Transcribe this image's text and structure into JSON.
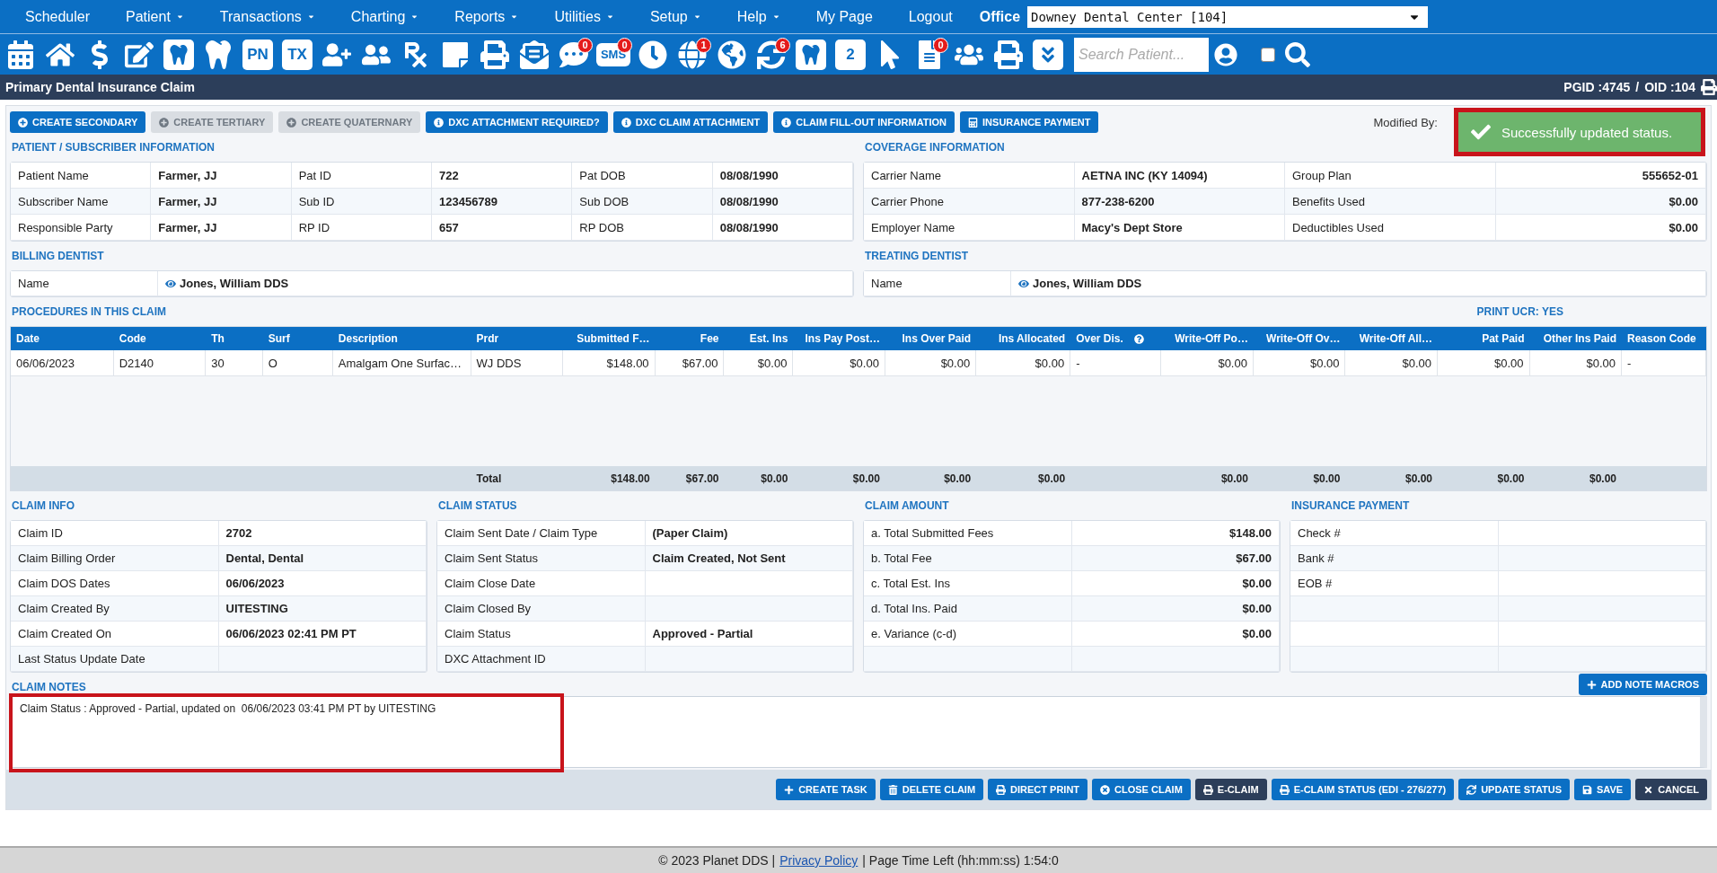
{
  "nav": {
    "items": [
      {
        "label": "Scheduler",
        "dropdown": false
      },
      {
        "label": "Patient",
        "dropdown": true
      },
      {
        "label": "Transactions",
        "dropdown": true
      },
      {
        "label": "Charting",
        "dropdown": true
      },
      {
        "label": "Reports",
        "dropdown": true
      },
      {
        "label": "Utilities",
        "dropdown": true
      },
      {
        "label": "Setup",
        "dropdown": true
      },
      {
        "label": "Help",
        "dropdown": true
      },
      {
        "label": "My Page",
        "dropdown": false
      },
      {
        "label": "Logout",
        "dropdown": false
      }
    ],
    "office_label": "Office",
    "office_value": "Downey Dental Center [104]"
  },
  "toolbar": {
    "items": [
      {
        "kind": "icon"
      },
      {
        "kind": "icon"
      },
      {
        "kind": "icon"
      },
      {
        "kind": "icon"
      },
      {
        "kind": "tile"
      },
      {
        "kind": "icon"
      },
      {
        "kind": "tile",
        "label": "PN"
      },
      {
        "kind": "tile",
        "label": "TX"
      },
      {
        "kind": "icon"
      },
      {
        "kind": "icon"
      },
      {
        "kind": "icon"
      },
      {
        "kind": "icon"
      },
      {
        "kind": "icon"
      },
      {
        "kind": "icon"
      },
      {
        "kind": "icon",
        "badge": "0"
      },
      {
        "kind": "bubble",
        "label": "SMS",
        "badge": "0"
      },
      {
        "kind": "icon"
      },
      {
        "kind": "icon",
        "badge": "1"
      },
      {
        "kind": "icon"
      },
      {
        "kind": "icon",
        "badge": "6"
      },
      {
        "kind": "tile"
      },
      {
        "kind": "tile",
        "label": "2"
      },
      {
        "kind": "icon"
      },
      {
        "kind": "icon",
        "badge": "0"
      },
      {
        "kind": "icon"
      },
      {
        "kind": "icon"
      },
      {
        "kind": "tile"
      }
    ],
    "search_placeholder": "Search Patient...",
    "checkbox_checked": false
  },
  "title_bar": {
    "title": "Primary Dental Insurance Claim",
    "pgid": "PGID :4745",
    "separator": "/",
    "oid": "OID :104"
  },
  "action_buttons": [
    {
      "label": "CREATE SECONDARY",
      "disabled": false
    },
    {
      "label": "CREATE TERTIARY",
      "disabled": true
    },
    {
      "label": "CREATE QUATERNARY",
      "disabled": true
    },
    {
      "label": "DXC ATTACHMENT REQUIRED?",
      "disabled": false
    },
    {
      "label": "DXC CLAIM ATTACHMENT",
      "disabled": false
    },
    {
      "label": "CLAIM FILL-OUT INFORMATION",
      "disabled": false
    },
    {
      "label": "INSURANCE PAYMENT",
      "disabled": false
    }
  ],
  "modified_by_label": "Modified By:",
  "toast": {
    "message": "Successfully updated status.",
    "highlighted": true
  },
  "patient_info": {
    "title": "PATIENT / SUBSCRIBER INFORMATION",
    "rows": [
      [
        "Patient Name",
        "Farmer, JJ",
        "Pat ID",
        "722",
        "Pat DOB",
        "08/08/1990"
      ],
      [
        "Subscriber Name",
        "Farmer, JJ",
        "Sub ID",
        "123456789",
        "Sub DOB",
        "08/08/1990"
      ],
      [
        "Responsible Party",
        "Farmer, JJ",
        "RP ID",
        "657",
        "RP DOB",
        "08/08/1990"
      ]
    ]
  },
  "coverage": {
    "title": "COVERAGE INFORMATION",
    "rows": [
      [
        "Carrier Name",
        "AETNA INC (KY 14094)",
        "Group Plan",
        "555652-01"
      ],
      [
        "Carrier Phone",
        "877-238-6200",
        "Benefits Used",
        "$0.00"
      ],
      [
        "Employer Name",
        "Macy's Dept Store",
        "Deductibles Used",
        "$0.00"
      ]
    ]
  },
  "billing_dentist": {
    "title": "BILLING DENTIST",
    "label": "Name",
    "value": "Jones, William DDS"
  },
  "treating_dentist": {
    "title": "TREATING DENTIST",
    "label": "Name",
    "value": "Jones, William DDS"
  },
  "procedures": {
    "title": "PROCEDURES IN THIS CLAIM",
    "print_ucr": "PRINT UCR: YES",
    "columns": [
      {
        "label": "Date",
        "right_aligned": false
      },
      {
        "label": "Code",
        "right_aligned": false
      },
      {
        "label": "Th",
        "right_aligned": false
      },
      {
        "label": "Surf",
        "right_aligned": false
      },
      {
        "label": "Description",
        "right_aligned": false
      },
      {
        "label": "Prdr",
        "right_aligned": false
      },
      {
        "label": "Submitted F…",
        "right_aligned": true
      },
      {
        "label": "Fee",
        "right_aligned": true
      },
      {
        "label": "Est. Ins",
        "right_aligned": true
      },
      {
        "label": "Ins Pay Post…",
        "right_aligned": true
      },
      {
        "label": "Ins Over Paid",
        "right_aligned": true
      },
      {
        "label": "Ins Allocated",
        "right_aligned": true
      },
      {
        "label": "Over Dis.",
        "right_aligned": false,
        "help": true
      },
      {
        "label": "Write-Off Po…",
        "right_aligned": true
      },
      {
        "label": "Write-Off Ov…",
        "right_aligned": true
      },
      {
        "label": "Write-Off All…",
        "right_aligned": true
      },
      {
        "label": "Pat Paid",
        "right_aligned": true
      },
      {
        "label": "Other Ins Paid",
        "right_aligned": true
      },
      {
        "label": "Reason Code",
        "right_aligned": false
      }
    ],
    "rows": [
      [
        "06/06/2023",
        "D2140",
        "30",
        "O",
        "Amalgam One Surfac…",
        "WJ DDS",
        "$148.00",
        "$67.00",
        "$0.00",
        "$0.00",
        "$0.00",
        "$0.00",
        "-",
        "$0.00",
        "$0.00",
        "$0.00",
        "$0.00",
        "$0.00",
        "-"
      ]
    ],
    "total_row": {
      "label": "Total",
      "values": [
        "$148.00",
        "$67.00",
        "$0.00",
        "$0.00",
        "$0.00",
        "$0.00",
        "$0.00",
        "$0.00",
        "$0.00",
        "$0.00",
        "$0.00"
      ]
    }
  },
  "claim_sections": [
    {
      "title": "CLAIM INFO",
      "kind": "text",
      "rows": [
        {
          "label": "Claim ID",
          "value": "2702"
        },
        {
          "label": "Claim Billing Order",
          "value": "Dental, Dental"
        },
        {
          "label": "Claim DOS Dates",
          "value": "06/06/2023"
        },
        {
          "label": "Claim Created By",
          "value": "UITESTING"
        },
        {
          "label": "Claim Created On",
          "value": "06/06/2023 02:41 PM PT"
        },
        {
          "label": "Last Status Update Date"
        }
      ]
    },
    {
      "title": "CLAIM STATUS",
      "kind": "text",
      "rows": [
        {
          "label": "Claim Sent Date / Claim Type",
          "value": "(Paper Claim)"
        },
        {
          "label": "Claim Sent Status",
          "value": "Claim Created, Not Sent"
        },
        {
          "label": "Claim Close Date"
        },
        {
          "label": "Claim Closed By"
        },
        {
          "label": "Claim Status",
          "value": "Approved - Partial"
        },
        {
          "label": "DXC Attachment ID"
        }
      ]
    },
    {
      "title": "CLAIM AMOUNT",
      "kind": "amount",
      "rows": [
        {
          "label": "a. Total Submitted Fees",
          "value": "$148.00"
        },
        {
          "label": "b. Total Fee",
          "value": "$67.00"
        },
        {
          "label": "c. Total Est. Ins",
          "value": "$0.00"
        },
        {
          "label": "d. Total Ins. Paid",
          "value": "$0.00"
        },
        {
          "label": "e. Variance (c-d)",
          "value": "$0.00"
        }
      ]
    },
    {
      "title": "INSURANCE PAYMENT",
      "kind": "text",
      "rows": [
        {
          "label": "Check #"
        },
        {
          "label": "Bank #"
        },
        {
          "label": "EOB #"
        }
      ]
    }
  ],
  "notes": {
    "title": "CLAIM NOTES",
    "add_button": "ADD NOTE MACROS",
    "text": "Claim Status : Approved - Partial, updated on  06/06/2023 03:41 PM PT by UITESTING",
    "highlighted": true
  },
  "bottom_buttons": [
    {
      "label": "CREATE TASK",
      "kind": "primary"
    },
    {
      "label": "DELETE CLAIM",
      "kind": "primary"
    },
    {
      "label": "DIRECT PRINT",
      "kind": "primary"
    },
    {
      "label": "CLOSE CLAIM",
      "kind": "primary"
    },
    {
      "label": "E-CLAIM",
      "kind": "dark"
    },
    {
      "label": "E-CLAIM STATUS (EDI - 276/277)",
      "kind": "primary"
    },
    {
      "label": "UPDATE STATUS",
      "kind": "primary"
    },
    {
      "label": "SAVE",
      "kind": "primary"
    },
    {
      "label": "CANCEL",
      "kind": "dark"
    }
  ],
  "footer": {
    "copyright": "© 2023 Planet DDS |",
    "link": "Privacy Policy",
    "time_left": "| Page Time Left (hh:mm:ss) 1:54:0"
  }
}
